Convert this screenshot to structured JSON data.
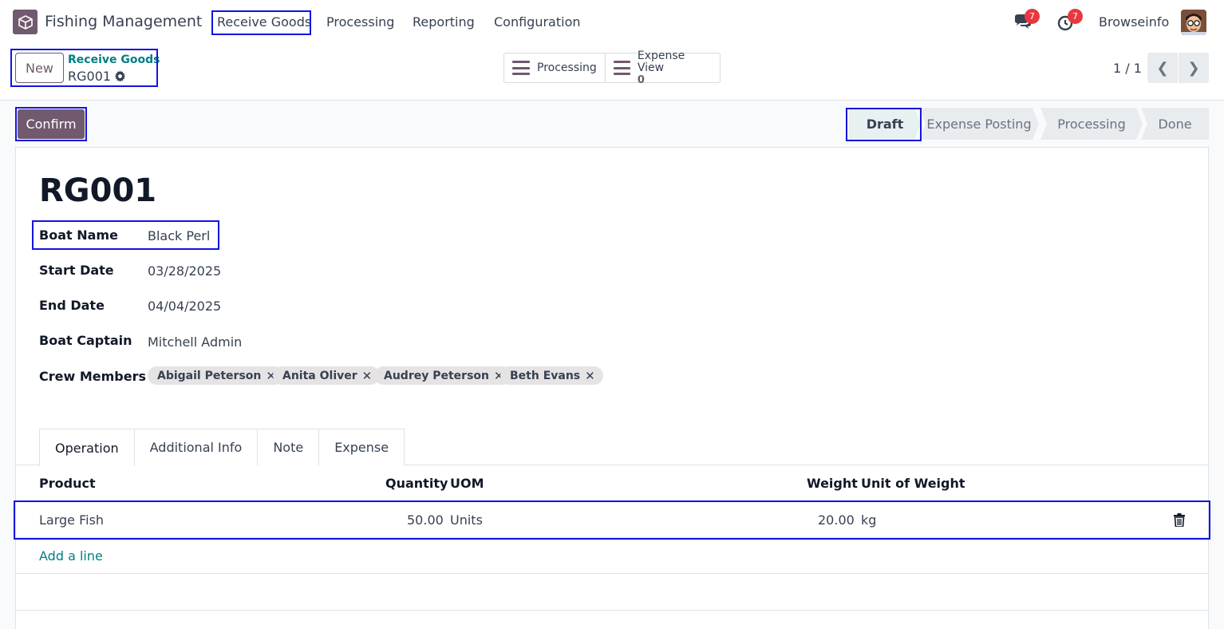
{
  "app": {
    "name": "Fishing Management"
  },
  "menu": {
    "items": [
      "Receive Goods",
      "Processing",
      "Reporting",
      "Configuration"
    ]
  },
  "systray": {
    "messages_count": "7",
    "activities_count": "7",
    "company": "Browseinfo"
  },
  "control": {
    "new_label": "New",
    "breadcrumb_parent": "Receive Goods",
    "breadcrumb_current": "RG001",
    "smart_buttons": [
      {
        "label": "Processing"
      },
      {
        "label": "Expense View",
        "value": "0"
      }
    ],
    "pager": "1 / 1"
  },
  "actions": {
    "confirm_label": "Confirm"
  },
  "statusbar": {
    "stages": [
      "Draft",
      "Expense Posting",
      "Processing",
      "Done"
    ],
    "active": "Draft"
  },
  "record": {
    "title": "RG001",
    "fields": [
      {
        "label": "Boat Name",
        "value": "Black Perl"
      },
      {
        "label": "Start Date",
        "value": "03/28/2025"
      },
      {
        "label": "End Date",
        "value": "04/04/2025"
      },
      {
        "label": "Boat Captain",
        "value": "Mitchell Admin"
      },
      {
        "label": "Crew Members"
      }
    ],
    "crew": [
      "Abigail Peterson",
      "Anita Oliver",
      "Audrey Peterson",
      "Beth Evans"
    ]
  },
  "tabs": [
    "Operation",
    "Additional Info",
    "Note",
    "Expense"
  ],
  "table": {
    "headers": [
      "Product",
      "Quantity",
      "UOM",
      "Weight",
      "Unit of Weight"
    ],
    "rows": [
      {
        "product": "Large Fish",
        "quantity": "50.00",
        "uom": "Units",
        "weight": "20.00",
        "unit_of_weight": "kg"
      }
    ],
    "add_line": "Add a line"
  },
  "colors": {
    "brand": "#71596e",
    "link": "#017e84",
    "highlight_box": "#1414e0",
    "badge": "#e8383f"
  }
}
